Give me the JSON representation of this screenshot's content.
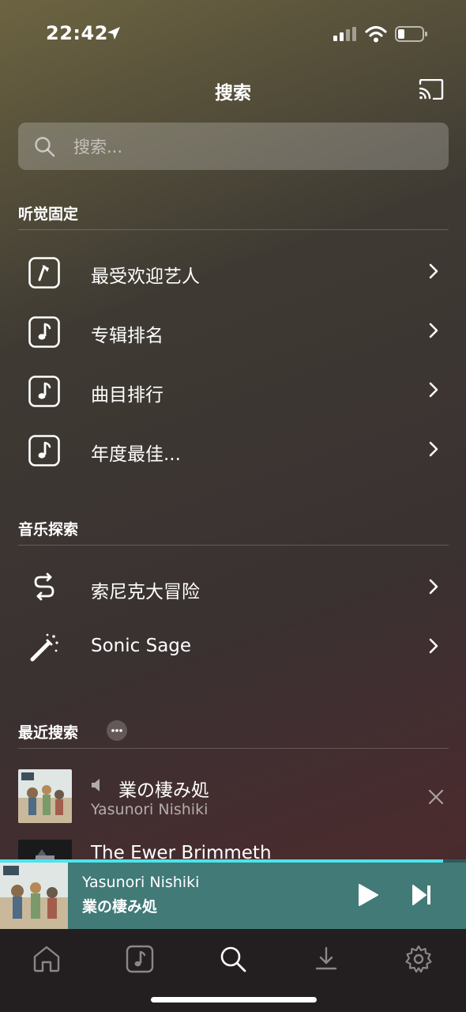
{
  "status_bar": {
    "time": "22:42"
  },
  "header": {
    "title": "搜索"
  },
  "search": {
    "placeholder": "搜索..."
  },
  "sections": {
    "charts": {
      "title": "听觉固定",
      "items": [
        {
          "label": "最受欢迎艺人",
          "icon": "microphone-icon"
        },
        {
          "label": "专辑排名",
          "icon": "music-note-icon"
        },
        {
          "label": "曲目排行",
          "icon": "music-note-icon"
        },
        {
          "label": "年度最佳...",
          "icon": "music-note-icon"
        }
      ]
    },
    "discovery": {
      "title": "音乐探索",
      "items": [
        {
          "label": "索尼克大冒险",
          "icon": "shuffle-path-icon"
        },
        {
          "label": "Sonic Sage",
          "icon": "magic-wand-icon"
        }
      ]
    },
    "recent": {
      "title": "最近搜索",
      "items": [
        {
          "title": "業の棲み処",
          "subtitle": "Yasunori Nishiki"
        },
        {
          "title": "The Ewer Brimmeth"
        }
      ]
    }
  },
  "now_playing": {
    "artist": "Yasunori Nishiki",
    "title": "業の棲み処",
    "progress": 0.95
  },
  "tabs": [
    "home-icon",
    "library-icon",
    "search-icon",
    "download-icon",
    "settings-icon"
  ],
  "colors": {
    "accent": "#4de3ea",
    "player_bg": "#417a77",
    "tab_bar_bg": "#231f21"
  }
}
